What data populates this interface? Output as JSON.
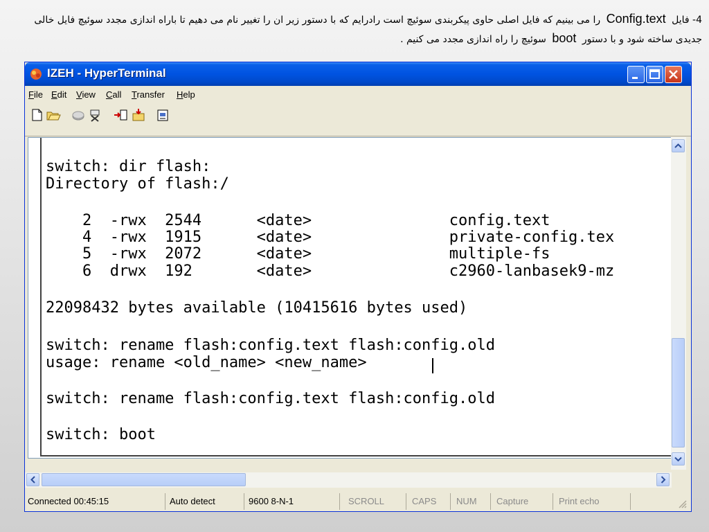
{
  "caption": {
    "part1": "4- فایل ",
    "term1": "Config.text",
    "part2": " را می بینیم که فایل اصلی حاوی پیکربندی سوئیچ است رادرایم که با دستور زیر ان را تغییر نام می دهیم تا باراه اندازی مجدد سوئیچ فایل خالی جدیدی ساخته شود و با دستور ",
    "term2": "boot",
    "part3": " سوئیچ را راه اندازی مجدد می کنیم ."
  },
  "window": {
    "title": "IZEH - HyperTerminal",
    "icon": "hyperterminal-icon"
  },
  "menu": [
    "File",
    "Edit",
    "View",
    "Call",
    "Transfer",
    "Help"
  ],
  "menu_access_keys": [
    "F",
    "E",
    "V",
    "C",
    "T",
    "H"
  ],
  "toolbar": [
    "new-icon",
    "open-icon",
    "disconnect-icon",
    "dial-icon",
    "send-icon",
    "receive-icon",
    "properties-icon"
  ],
  "terminal": {
    "lines": [
      "switch: dir flash:",
      "Directory of flash:/",
      "    2  -rwx  2544      <date>               config.text",
      "    4  -rwx  1915      <date>               private-config.tex",
      "    5  -rwx  2072      <date>               multiple-fs",
      "    6  drwx  192       <date>               c2960-lanbasek9-mz",
      "22098432 bytes available (10415616 bytes used)",
      "switch: rename flash:config.text flash:config.old",
      "usage: rename <old_name> <new_name>",
      "switch: rename flash:config.text flash:config.old",
      "switch: boot"
    ]
  },
  "status": {
    "connected": "Connected 00:45:15",
    "detect": "Auto detect",
    "settings": "9600 8-N-1",
    "scroll": "SCROLL",
    "caps": "CAPS",
    "num": "NUM",
    "capture": "Capture",
    "echo": "Print echo"
  }
}
